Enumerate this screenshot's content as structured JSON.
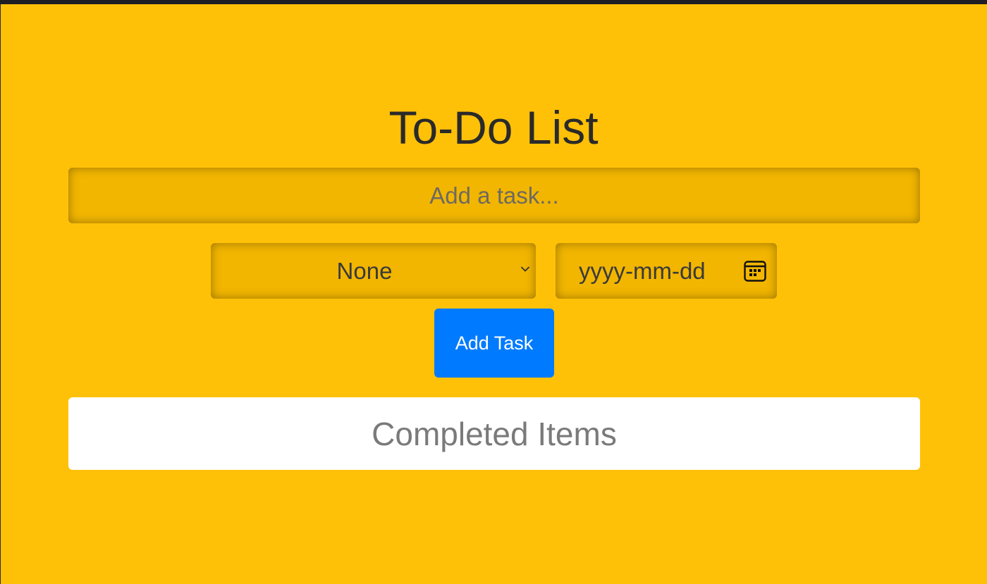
{
  "app": {
    "title": "To-Do List"
  },
  "task_input": {
    "placeholder": "Add a task...",
    "value": ""
  },
  "priority_select": {
    "selected": "None",
    "icon": "chevron-down-icon"
  },
  "due_date": {
    "placeholder": "yyyy-mm-dd",
    "icon": "calendar-icon"
  },
  "add_button": {
    "label": "Add Task",
    "color": "#007bff"
  },
  "completed": {
    "heading": "Completed Items"
  },
  "colors": {
    "background": "#ffc107",
    "panel": "#ffffff"
  }
}
